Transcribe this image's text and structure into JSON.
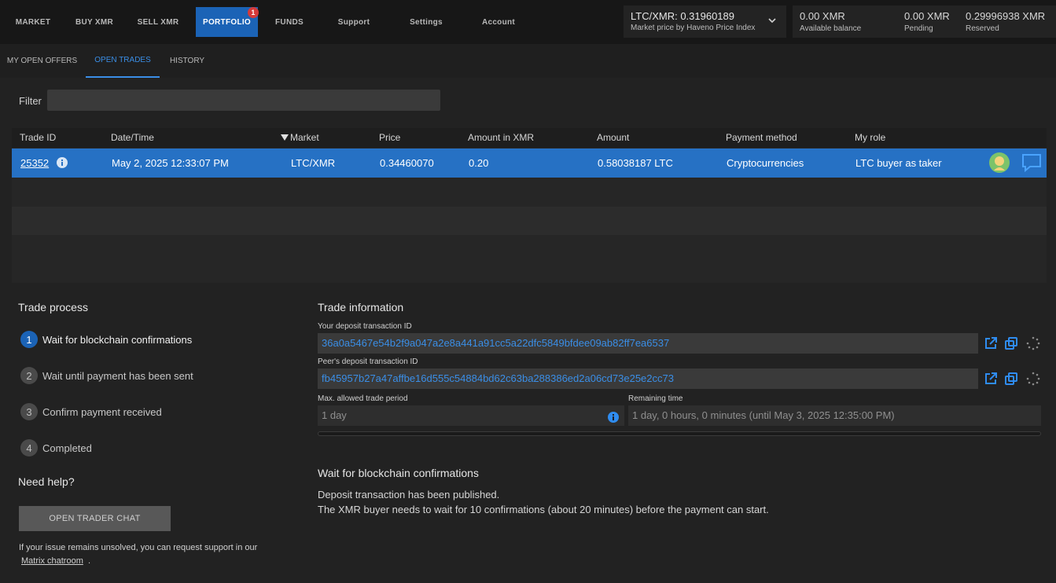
{
  "nav": {
    "items": [
      {
        "label": "MARKET"
      },
      {
        "label": "BUY XMR"
      },
      {
        "label": "SELL XMR"
      },
      {
        "label": "PORTFOLIO",
        "badge": "1"
      },
      {
        "label": "FUNDS"
      },
      {
        "label": "Support"
      },
      {
        "label": "Settings"
      },
      {
        "label": "Account"
      }
    ],
    "active": "PORTFOLIO"
  },
  "market": {
    "price": "LTC/XMR: 0.31960189",
    "source": "Market price by Haveno Price Index"
  },
  "balances": [
    {
      "value": "0.00 XMR",
      "label": "Available balance"
    },
    {
      "value": "0.00 XMR",
      "label": "Pending"
    },
    {
      "value": "0.29996938 XMR",
      "label": "Reserved"
    }
  ],
  "subtabs": [
    {
      "label": "MY OPEN OFFERS"
    },
    {
      "label": "OPEN TRADES"
    },
    {
      "label": "HISTORY"
    }
  ],
  "filter": {
    "label": "Filter",
    "value": ""
  },
  "table": {
    "columns": [
      "Trade ID",
      "Date/Time",
      "Market",
      "Price",
      "Amount in XMR",
      "Amount",
      "Payment method",
      "My role"
    ],
    "sort_column": "Market",
    "rows": [
      {
        "trade_id": "25352",
        "datetime": "May 2, 2025 12:33:07 PM",
        "market": "LTC/XMR",
        "price": "0.34460070",
        "amount_xmr": "0.20",
        "amount": "0.58038187 LTC",
        "payment_method": "Cryptocurrencies",
        "role": "LTC buyer as taker"
      }
    ]
  },
  "trade_process": {
    "title": "Trade process",
    "steps": [
      {
        "num": "1",
        "label": "Wait for blockchain confirmations"
      },
      {
        "num": "2",
        "label": "Wait until payment has been sent"
      },
      {
        "num": "3",
        "label": "Confirm payment received"
      },
      {
        "num": "4",
        "label": "Completed"
      }
    ],
    "active_step": 1
  },
  "help": {
    "title": "Need help?",
    "button": "OPEN TRADER CHAT",
    "text": "If your issue remains unsolved, you can request support in our",
    "link": "Matrix chatroom",
    "suffix": "."
  },
  "trade_info": {
    "title": "Trade information",
    "deposit_label": "Your deposit transaction ID",
    "deposit_tx": "36a0a5467e54b2f9a047a2e8a441a91cc5a22dfc5849bfdee09ab82ff7ea6537",
    "peer_label": "Peer's deposit transaction ID",
    "peer_tx": "fb45957b27a47affbe16d555c54884bd62c63ba288386ed2a06cd73e25e2cc73",
    "period_label": "Max. allowed trade period",
    "period_value": "1 day",
    "remaining_label": "Remaining time",
    "remaining_value": "1 day, 0 hours, 0 minutes (until May 3, 2025 12:35:00 PM)",
    "progress": 0
  },
  "status": {
    "title": "Wait for blockchain confirmations",
    "line1": "Deposit transaction has been published.",
    "line2": "The XMR buyer needs to wait for 10 confirmations (about 20 minutes) before the payment can start."
  },
  "colors": {
    "accent": "#1b63b6",
    "link": "#3a8ee6",
    "badge": "#d43a3a"
  }
}
